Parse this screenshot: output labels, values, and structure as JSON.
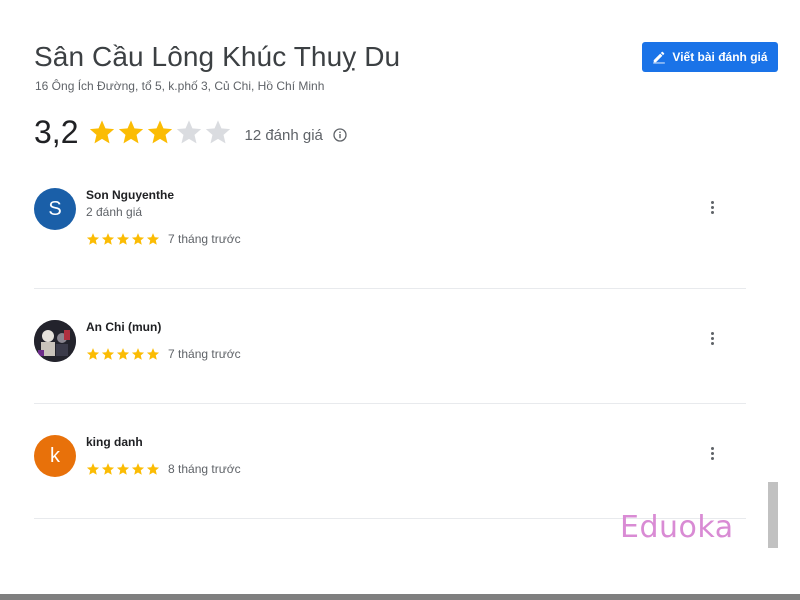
{
  "place": {
    "title": "Sân Cầu Lông Khúc Thuỵ Du",
    "address": "16 Ông Ích Đường, tổ 5, k.phố 3, Củ Chi, Hồ Chí Minh"
  },
  "write_review_button": {
    "label": "Viết bài đánh giá",
    "icon": "pencil-icon"
  },
  "rating": {
    "value": "3,2",
    "stars": 3,
    "max_stars": 5,
    "count_label": "12 đánh giá",
    "info_icon": "info-icon"
  },
  "reviews": [
    {
      "avatar_letter": "S",
      "avatar_color": "#1a5fa8",
      "name": "Son Nguyenthe",
      "meta": "2 đánh giá",
      "stars": 5,
      "time": "7 tháng trước"
    },
    {
      "avatar_letter": "",
      "avatar_color": "#2a2a35",
      "name": "An Chi (mun)",
      "meta": "",
      "stars": 5,
      "time": "7 tháng trước"
    },
    {
      "avatar_letter": "k",
      "avatar_color": "#e8710a",
      "name": "king danh",
      "meta": "",
      "stars": 5,
      "time": "8 tháng trước"
    }
  ],
  "watermark": "Eduoka",
  "colors": {
    "accent": "#1a73e8",
    "star_filled": "#fbbc04",
    "star_empty": "#dadce0"
  }
}
